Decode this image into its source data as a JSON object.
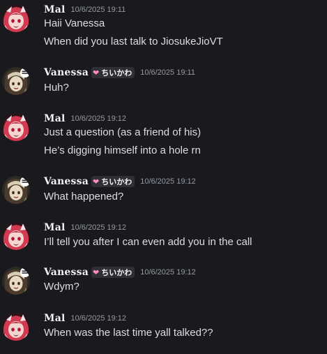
{
  "messages": [
    {
      "author": "Mal",
      "tag_text": "",
      "timestamp": "10/6/2025 19:11",
      "lines": [
        "Haii Vanessa",
        "When did you last talk to JiosukeJioVT"
      ]
    },
    {
      "author": "Vanessa",
      "tag_text": "ちいかわ",
      "timestamp": "10/6/2025 19:11",
      "lines": [
        "Huh?"
      ]
    },
    {
      "author": "Mal",
      "tag_text": "",
      "timestamp": "10/6/2025 19:12",
      "lines": [
        "Just a question (as a friend of his)",
        "He’s digging himself into a hole rn"
      ]
    },
    {
      "author": "Vanessa",
      "tag_text": "ちいかわ",
      "timestamp": "10/6/2025 19:12",
      "lines": [
        "What happened?"
      ]
    },
    {
      "author": "Mal",
      "tag_text": "",
      "timestamp": "10/6/2025 19:12",
      "lines": [
        "I’ll tell you after I can even add you in the call"
      ]
    },
    {
      "author": "Vanessa",
      "tag_text": "ちいかわ",
      "timestamp": "10/6/2025 19:12",
      "lines": [
        "Wdym?"
      ]
    },
    {
      "author": "Mal",
      "tag_text": "",
      "timestamp": "10/6/2025 19:12",
      "lines": [
        "When was the last time yall talked??"
      ]
    }
  ],
  "colors": {
    "background": "#1a1a1e",
    "username": "#f2f3f5",
    "timestamp": "#949ba4",
    "message_text": "#dbdee1",
    "tag_background": "#2f3035",
    "tag_heart": "#ff8fc0"
  },
  "icons": {
    "mal_avatar": "red-haired-character-avatar",
    "vanessa_avatar": "hooded-character-avatar",
    "tag_icon": "pink-heart-icon"
  }
}
